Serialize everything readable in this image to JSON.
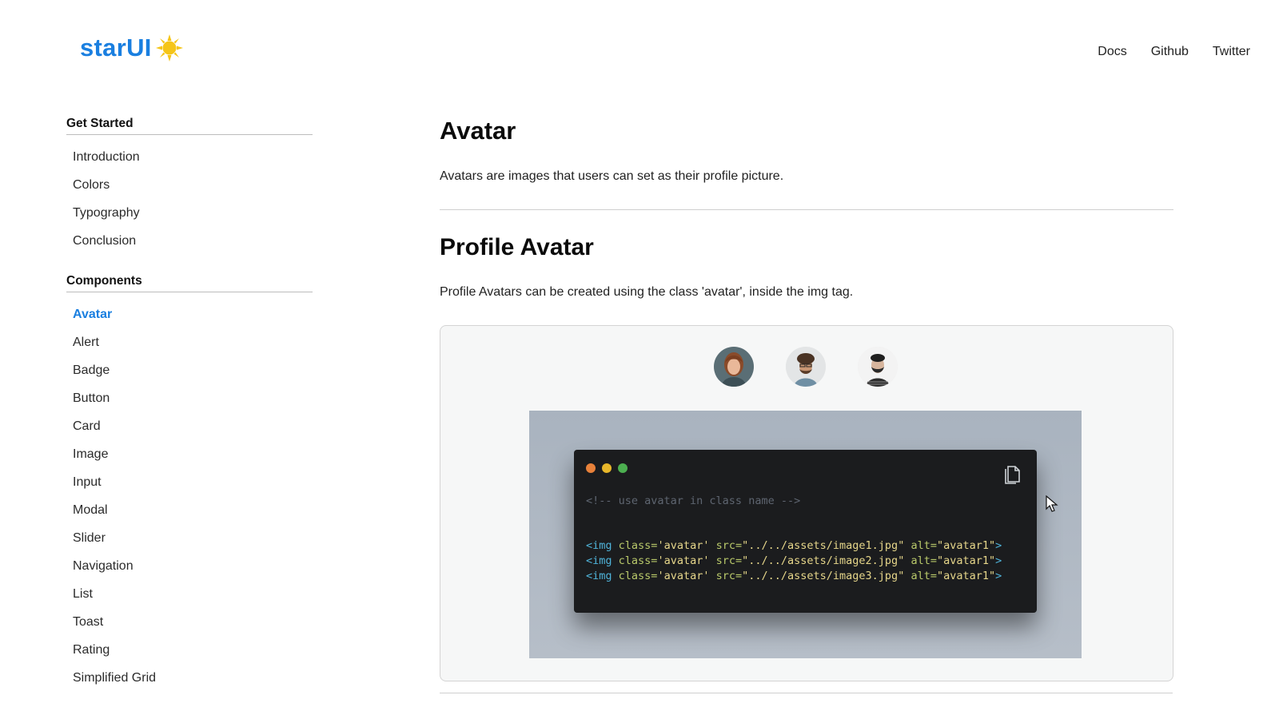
{
  "header": {
    "logo_text": "starUI",
    "nav": [
      "Docs",
      "Github",
      "Twitter"
    ]
  },
  "sidebar": {
    "group1": {
      "heading": "Get Started",
      "items": [
        "Introduction",
        "Colors",
        "Typography",
        "Conclusion"
      ]
    },
    "group2": {
      "heading": "Components",
      "items": [
        "Avatar",
        "Alert",
        "Badge",
        "Button",
        "Card",
        "Image",
        "Input",
        "Modal",
        "Slider",
        "Navigation",
        "List",
        "Toast",
        "Rating",
        "Simplified Grid"
      ],
      "active": "Avatar"
    }
  },
  "main": {
    "title": "Avatar",
    "description": "Avatars are images that users can set as their profile picture.",
    "section_title": "Profile Avatar",
    "section_description": "Profile Avatars can be created using the class 'avatar', inside the img tag."
  },
  "code": {
    "comment": "<!-- use avatar in class name -->",
    "lines": [
      {
        "tag": "<img",
        "class_attr": "class=",
        "class_val": "'avatar'",
        "src_attr": "src=",
        "src_val": "\"../../assets/image1.jpg\"",
        "alt_attr": "alt=",
        "alt_val": "\"avatar1\"",
        "close": ">"
      },
      {
        "tag": "<img",
        "class_attr": "class=",
        "class_val": "'avatar'",
        "src_attr": "src=",
        "src_val": "\"../../assets/image2.jpg\"",
        "alt_attr": "alt=",
        "alt_val": "\"avatar1\"",
        "close": ">"
      },
      {
        "tag": "<img",
        "class_attr": "class=",
        "class_val": "'avatar'",
        "src_attr": "src=",
        "src_val": "\"../../assets/image3.jpg\"",
        "alt_attr": "alt=",
        "alt_val": "\"avatar1\"",
        "close": ">"
      }
    ]
  },
  "colors": {
    "brand": "#1a7fe0",
    "dot_red": "#e8813a",
    "dot_yellow": "#e8b72a",
    "dot_green": "#4caf50"
  },
  "icons": {
    "logo": "sun-icon",
    "copy": "copy-icon",
    "cursor": "mouse-pointer-icon"
  }
}
